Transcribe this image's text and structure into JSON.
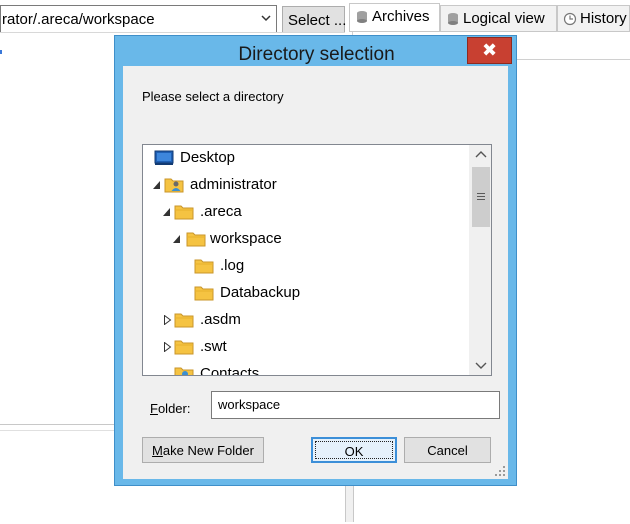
{
  "app": {
    "path_value": "rator/.areca/workspace",
    "select_button": "Select ...",
    "tabs": [
      {
        "label": "Archives",
        "icon": "database-icon",
        "active": true
      },
      {
        "label": "Logical view",
        "icon": "database-icon",
        "active": false
      },
      {
        "label": "History",
        "icon": "clock-icon",
        "active": false
      }
    ]
  },
  "dialog": {
    "title": "Directory selection",
    "close_glyph": "✖",
    "prompt": "Please select a directory",
    "tree": [
      {
        "label": "Desktop",
        "icon": "desktop-icon",
        "depth": 0,
        "state": "none"
      },
      {
        "label": "administrator",
        "icon": "user-folder-icon",
        "depth": 0,
        "state": "expanded"
      },
      {
        "label": ".areca",
        "icon": "folder-icon",
        "depth": 1,
        "state": "expanded"
      },
      {
        "label": "workspace",
        "icon": "folder-icon",
        "depth": 2,
        "state": "expanded",
        "selected": true
      },
      {
        "label": ".log",
        "icon": "folder-icon",
        "depth": 3,
        "state": "none"
      },
      {
        "label": "Databackup",
        "icon": "folder-icon",
        "depth": 3,
        "state": "none"
      },
      {
        "label": ".asdm",
        "icon": "folder-icon",
        "depth": 1,
        "state": "collapsed"
      },
      {
        "label": ".swt",
        "icon": "folder-icon",
        "depth": 1,
        "state": "collapsed"
      },
      {
        "label": "Contacts",
        "icon": "contacts-folder-icon",
        "depth": 1,
        "state": "none"
      }
    ],
    "folder_label": "Folder:",
    "folder_value": "workspace",
    "buttons": {
      "new_folder": "Make New Folder",
      "ok": "OK",
      "cancel": "Cancel"
    }
  },
  "colors": {
    "dialog_frame": "#69b8e9",
    "close_button": "#c84031",
    "folder": "#f5c342",
    "selection": "#f2f2f2"
  }
}
